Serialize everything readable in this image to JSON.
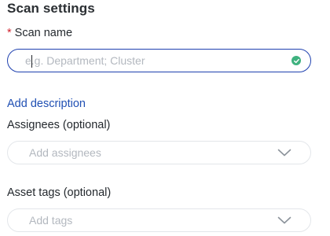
{
  "section": {
    "title": "Scan settings"
  },
  "scan_name": {
    "required_marker": "*",
    "label": "Scan name",
    "placeholder": "e.g. Department; Cluster",
    "status_icon": "check-circle-icon",
    "status_color": "#3fb27f"
  },
  "add_description": {
    "label": "Add description"
  },
  "assignees": {
    "label": "Assignees (optional)",
    "placeholder": "Add assignees",
    "icon": "chevron-down-icon"
  },
  "asset_tags": {
    "label": "Asset tags (optional)",
    "placeholder": "Add tags",
    "icon": "chevron-down-icon"
  },
  "colors": {
    "focus_border": "#1e40af",
    "link": "#1f4fb3",
    "required": "#d1242f"
  }
}
